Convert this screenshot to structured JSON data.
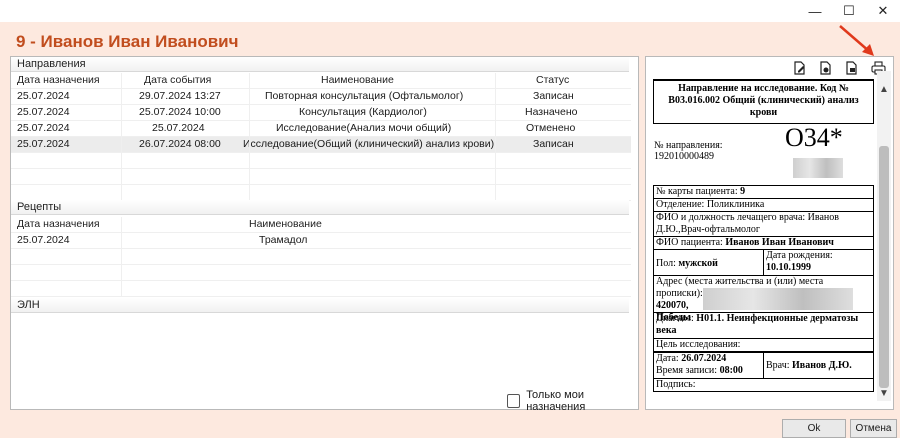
{
  "window": {
    "minimize": "—",
    "maximize": "☐",
    "close": "✕"
  },
  "page_title": "9 - Иванов Иван Иванович",
  "directions": {
    "section_label": "Направления",
    "columns": [
      "Дата назначения",
      "Дата события",
      "Наименование",
      "Статус"
    ],
    "rows": [
      [
        "25.07.2024",
        "29.07.2024 13:27",
        "Повторная консультация (Офтальмолог)",
        "Записан"
      ],
      [
        "25.07.2024",
        "25.07.2024 10:00",
        "Консультация (Кардиолог)",
        "Назначено"
      ],
      [
        "25.07.2024",
        "25.07.2024",
        "Исследование(Анализ мочи общий)",
        "Отменено"
      ],
      [
        "25.07.2024",
        "26.07.2024 08:00",
        "Исследование(Общий (клинический) анализ крови)",
        "Записан"
      ]
    ]
  },
  "recipes": {
    "section_label": "Рецепты",
    "columns": [
      "Дата назначения",
      "Наименование"
    ],
    "rows": [
      [
        "25.07.2024",
        "Трамадол"
      ]
    ]
  },
  "eln": {
    "section_label": "ЭЛН"
  },
  "only_mine_label": "Только мои назначения",
  "doc": {
    "title": "Направление на исследование. Код № В03.016.002 Общий (клинический) анализ крови",
    "direction_no_label": "№ направления:",
    "direction_no": "192010000489",
    "code": "О34*",
    "card_label": "№ карты пациента:",
    "card_value": "9",
    "department": "Отделение: Поликлиника",
    "doctor_full": "ФИО и должность лечащего врача: Иванов Д.Ю.,Врач-офтальмолог",
    "patient_label": "ФИО пациента:",
    "patient_value": "Иванов Иван Иванович",
    "sex_label": "Пол:",
    "sex_value": "мужской",
    "dob_label": "Дата рождения:",
    "dob_value": "10.10.1999",
    "address_label": "Адрес (места жительства и (или) места прописки):",
    "address_line1": "420070,",
    "address_line2": "Победы",
    "diagnosis_label": "Диагноз:",
    "diagnosis_value": "Н01.1. Неинфекционные дерматозы века",
    "goal_label": "Цель исследования:",
    "date_label": "Дата:",
    "date_value": "26.07.2024",
    "time_label": "Время записи:",
    "time_value": "08:00",
    "doctor_label": "Врач:",
    "doctor_value": "Иванов Д.Ю.",
    "sign_label": "Подпись:"
  },
  "buttons": {
    "ok": "Ok",
    "cancel": "Отмена"
  },
  "colors": {
    "accent": "#c14d1e",
    "bg": "#fde9df",
    "arrow": "#e0391c"
  }
}
